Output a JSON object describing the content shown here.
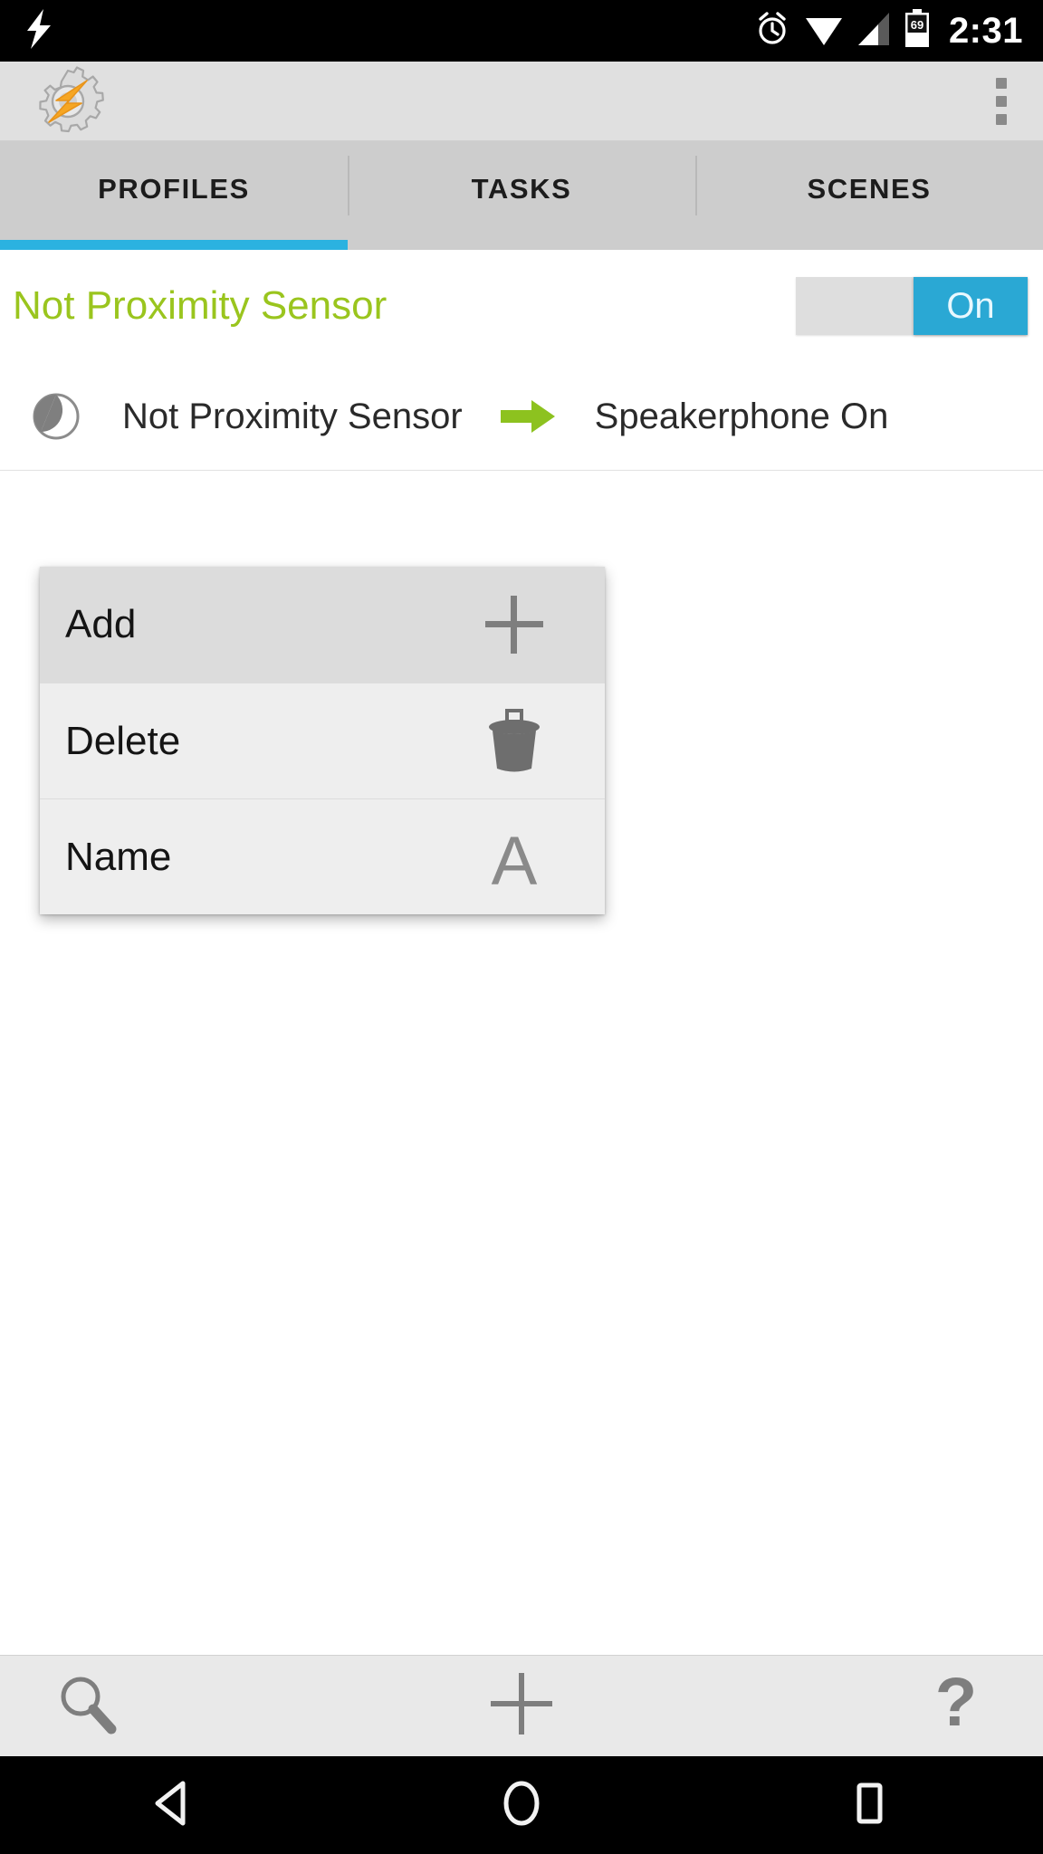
{
  "status_bar": {
    "charging_icon": "lightning-bolt-icon",
    "alarm_icon": "alarm-clock-icon",
    "wifi_icon": "wifi-icon",
    "signal_icon": "cell-signal-icon",
    "battery_icon": "battery-icon",
    "battery_level": "69",
    "time": "2:31"
  },
  "app_bar": {
    "logo_icon": "tasker-gear-bolt-logo",
    "overflow_icon": "overflow-menu-icon"
  },
  "tabs": {
    "active_index": 0,
    "items": [
      {
        "label": "PROFILES"
      },
      {
        "label": "TASKS"
      },
      {
        "label": "SCENES"
      }
    ]
  },
  "profile": {
    "name": "Not Proximity Sensor",
    "toggle_label": "On",
    "toggle_state": "on",
    "row": {
      "state_icon": "half-filled-circle-icon",
      "context": "Not Proximity Sensor",
      "arrow_icon": "green-right-arrow-icon",
      "task": "Speakerphone On"
    }
  },
  "context_menu": {
    "items": [
      {
        "label": "Add",
        "icon": "plus-icon",
        "highlighted": true
      },
      {
        "label": "Delete",
        "icon": "trash-icon",
        "highlighted": false
      },
      {
        "label": "Name",
        "icon": "letter-a-icon",
        "highlighted": false
      }
    ]
  },
  "bottom_bar": {
    "search_icon": "search-icon",
    "add_icon": "plus-icon",
    "help_icon": "question-mark-icon"
  },
  "nav_bar": {
    "back_icon": "back-triangle-icon",
    "home_icon": "home-circle-icon",
    "recents_icon": "recents-square-icon"
  },
  "colors": {
    "accent_blue": "#2bb2e0",
    "profile_green": "#9ac51e",
    "arrow_green": "#8dc21f",
    "appbar_gray": "#e0e0e0",
    "tabbar_gray": "#cdcdcd"
  }
}
